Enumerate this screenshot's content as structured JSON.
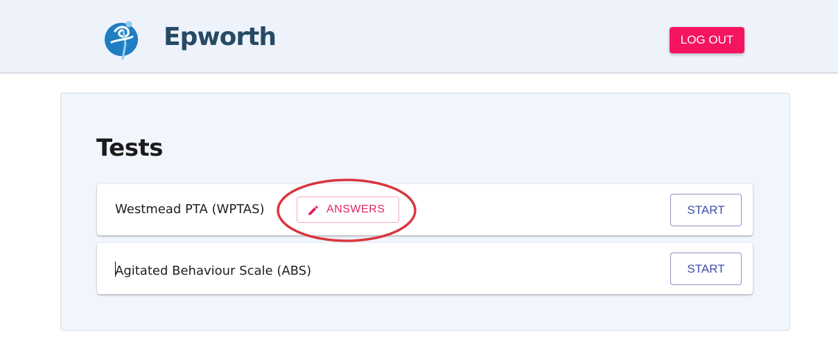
{
  "header": {
    "brand": "Epworth",
    "logout_label": "LOG OUT",
    "logo_icon": "epworth-figure-logo",
    "background_color": "#eef2fb"
  },
  "main": {
    "title": "Tests",
    "tests": [
      {
        "name": "Westmead PTA (WPTAS)",
        "answers_label": "ANSWERS",
        "answers_icon": "pencil-icon",
        "start_label": "START"
      },
      {
        "name": "Agitated Behaviour Scale (ABS)",
        "start_label": "START"
      }
    ]
  },
  "colors": {
    "accent": "#f5145e",
    "brand_text": "#264a63",
    "logo_blue": "#1f7dc2",
    "start_text": "#3f4fa8",
    "annotation": "#d9363e"
  }
}
